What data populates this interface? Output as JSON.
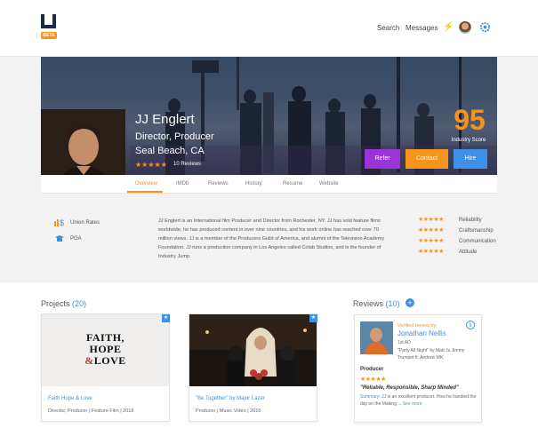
{
  "nav": {
    "logo_badge": "BETA",
    "search": "Search",
    "messages": "Messages"
  },
  "profile": {
    "name": "JJ Englert",
    "title": "Director, Producer",
    "location": "Seal Beach, CA",
    "stars": "★★★★★",
    "reviews": "10 Reviews",
    "score": "95",
    "score_label": "Industry Score",
    "buttons": {
      "refer": "Refer",
      "contact": "Contact",
      "hire": "Hire"
    }
  },
  "tabs": [
    "Overview",
    "IMDb",
    "Reviews",
    "History",
    "Resume",
    "Website"
  ],
  "affiliations": [
    {
      "label": "Union Rates",
      "icon": "union-rates-icon"
    },
    {
      "label": "PGA",
      "icon": "pga-icon"
    }
  ],
  "bio": "JJ Englert is an International film Producer and Director from Rochester, NY. JJ has sold feature films worldwide, he has produced content in over nine countries, and his work online has reached over 70 million views. JJ is a member of the Producers Guild of America, and alumni of the Television Academy Foundation. JJ runs a production company in Los Angeles called Colab Studios, and is the founder of Industry Jump.",
  "skills": [
    {
      "stars": "★★★★★",
      "label": "Reliability"
    },
    {
      "stars": "★★★★★",
      "label": "Craftsmanship"
    },
    {
      "stars": "★★★★★",
      "label": "Communication"
    },
    {
      "stars": "★★★★★",
      "label": "Attitude"
    }
  ],
  "projects": {
    "heading": "Projects",
    "count": "(20)",
    "items": [
      {
        "title": "Faith Hope & Love",
        "meta": "Director, Producer | Feature Film | 2018",
        "poster_line1": "FAITH,",
        "poster_line2": "HOPE",
        "poster_amp": "&",
        "poster_line3": "LOVE"
      },
      {
        "title": "\"Be Together\" by Major Lazer",
        "meta": "Producer | Music Video | 2016"
      }
    ]
  },
  "reviews": {
    "heading": "Reviews",
    "count": "(10)",
    "add": "+",
    "card": {
      "verified": "Verified review by:",
      "name": "Jonathan Nellis",
      "role": "1st AD",
      "project": "\"Party All Night\" by Matt Ju Jimmy Trumpet ft. Andrew WK",
      "category": "Producer",
      "stars": "★★★★★",
      "quote": "\"Reliable, Responsible, Sharp Minded\"",
      "summary_label": "Summary:",
      "summary": " JJ is an excellent producer. How he handled the day on the Making ...",
      "see_more": "See more"
    }
  },
  "colors": {
    "accent": "#f7941d",
    "link": "#3e8fe8",
    "refer": "#9b33d6"
  }
}
